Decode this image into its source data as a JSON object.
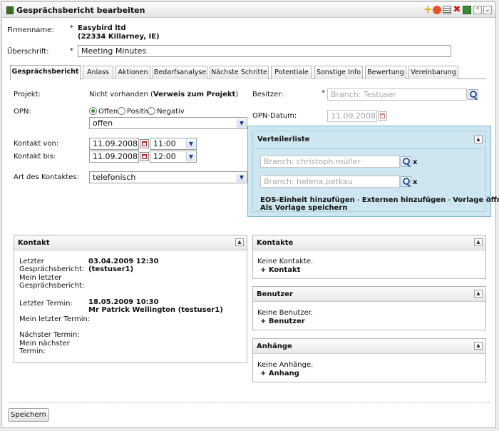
{
  "window": {
    "title": "Gesprächsbericht bearbeiten"
  },
  "toolbar_icons": [
    "add-icon",
    "flag-icon",
    "list-icon",
    "delete-icon",
    "export-icon",
    "collapse-icon",
    "expand-icon"
  ],
  "header": {
    "firmenname_label": "Firmenname:",
    "firmenname_name": "Easybird ltd",
    "firmenname_address": "(22334 Killarney, IE)",
    "ueberschrift_label": "Überschrift:",
    "ueberschrift_value": "Meeting Minutes",
    "required_mark": "*"
  },
  "tabs": [
    {
      "label": "Gesprächsbericht",
      "active": true
    },
    {
      "label": "Anlass"
    },
    {
      "label": "Aktionen"
    },
    {
      "label": "Bedarfsanalyse"
    },
    {
      "label": "Nächste Schritte"
    },
    {
      "label": "Potentiale"
    },
    {
      "label": "Sonstige Info"
    },
    {
      "label": "Bewertung"
    },
    {
      "label": "Vereinbarung"
    }
  ],
  "form": {
    "projekt_label": "Projekt:",
    "projekt_value": "Nicht vorhanden (",
    "projekt_link": "Verweis zum Projekt",
    "projekt_close": ")",
    "opn_label": "OPN:",
    "opn_options": [
      "Offen",
      "Positiv",
      "Negativ"
    ],
    "opn_selected": "offen",
    "kontakt_von_label": "Kontakt von:",
    "kontakt_von_date": "11.09.2008",
    "kontakt_von_time": "11:00",
    "kontakt_bis_label": "Kontakt bis:",
    "kontakt_bis_date": "11.09.2008",
    "kontakt_bis_time": "12:00",
    "art_label": "Art des Kontaktes:",
    "art_value": "telefonisch",
    "besitzer_label": "Besitzer:",
    "besitzer_placeholder": "Branch: Testuser",
    "opn_datum_label": "OPN-Datum:",
    "opn_datum_value": "11.09.2008"
  },
  "verteilerliste": {
    "title": "Verteilerliste",
    "entries": [
      "Branch: christoph.müller",
      "Branch: helena.petkau"
    ],
    "remove": "x",
    "link_eos": "EOS-Einheit hinzufügen",
    "sep": "-",
    "link_extern": "Externen hinzufügen",
    "link_vorlage": "Vorlage öffnen",
    "link_speichern": "Als Vorlage speichern"
  },
  "kontakt_panel": {
    "title": "Kontakt",
    "letzter_label_1": "Letzter",
    "letzter_label_2": "Gesprächsbericht:",
    "letzter_date": "03.04.2009 12:30",
    "letzter_user": "(testuser1)",
    "mein_letzter_1": "Mein letzter",
    "mein_letzter_2": "Gesprächsbericht:",
    "letzter_termin_label": "Letzter Termin:",
    "letzter_termin_date": "18.05.2009 10:30",
    "letzter_termin_user": "Mr Patrick Wellington (testuser1)",
    "mein_letzter_termin": "Mein letzter Termin:",
    "naechster_termin": "Nächster Termin:",
    "mein_naechster_1": "Mein nächster",
    "mein_naechster_2": "Termin:"
  },
  "kontakte_panel": {
    "title": "Kontakte",
    "empty": "Keine Kontakte.",
    "add": "+ Kontakt"
  },
  "benutzer_panel": {
    "title": "Benutzer",
    "empty": "Keine Benutzer.",
    "add": "+ Benutzer"
  },
  "anhaenge_panel": {
    "title": "Anhänge",
    "empty": "Keine Anhänge.",
    "add": "+ Anhang"
  },
  "footer": {
    "save_label": "Speichern"
  },
  "colors": {
    "accent_green": "#3d6b22",
    "verteiler_bg": "#cde6f0",
    "verteiler_border": "#7fb8cf"
  }
}
